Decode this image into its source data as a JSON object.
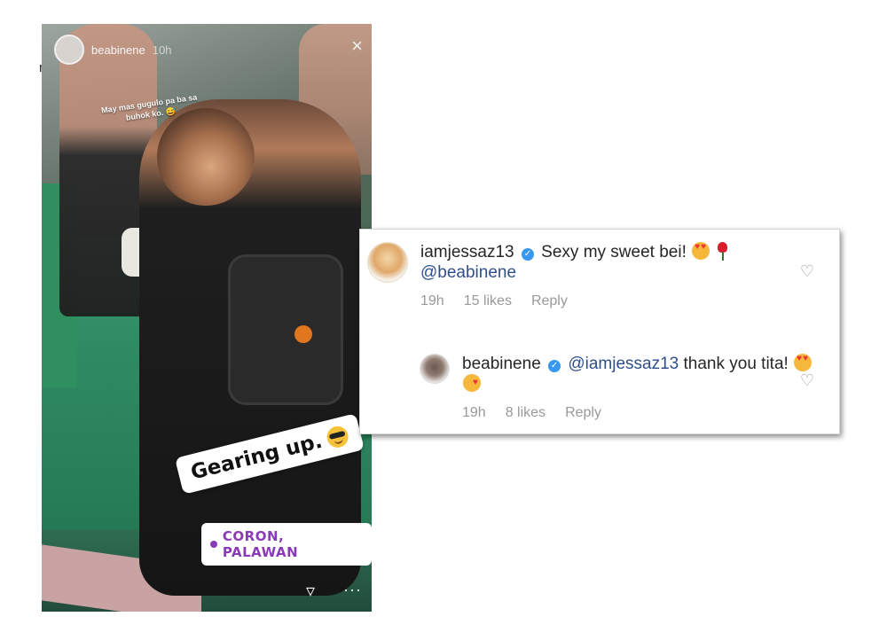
{
  "side_label": "nfo",
  "story": {
    "username": "beabinene",
    "time": "10h",
    "close_glyph": "×",
    "caption": "May mas gugulo pa ba sa buhok ko. 😅",
    "sticker_text": "Gearing up.",
    "location": "CORON, PALAWAN",
    "icons": [
      "send-icon",
      "more-icon",
      "close-icon",
      "location-pin-icon"
    ]
  },
  "comments": [
    {
      "username": "iamjessaz13",
      "verified": true,
      "text": "Sexy my sweet bei!",
      "mention": "@beabinene",
      "time": "19h",
      "likes": "15 likes",
      "reply_label": "Reply"
    },
    {
      "username": "beabinene",
      "verified": true,
      "mention": "@iamjessaz13",
      "text": "thank you tita!",
      "time": "19h",
      "likes": "8 likes",
      "reply_label": "Reply"
    }
  ],
  "colors": {
    "location_text": "#8a3ab9",
    "verified_badge": "#3897f0",
    "mention": "#2f4f8a",
    "meta_text": "#999999"
  }
}
